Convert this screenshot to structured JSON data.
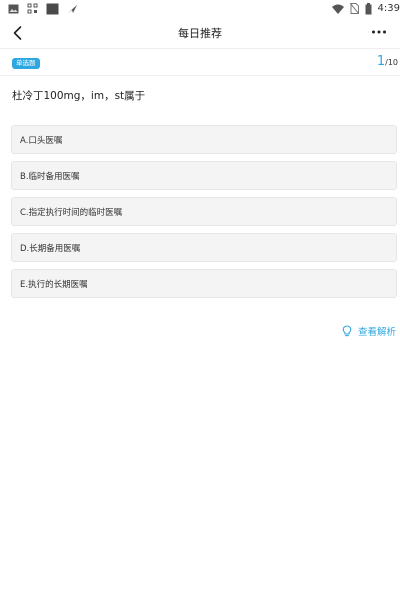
{
  "colors": {
    "accent": "#2ea7e0",
    "option_bg": "#f4f4f4",
    "option_border": "#e6e6e6"
  },
  "status_bar": {
    "time": "4:39",
    "left_icons": [
      "image-icon",
      "qr-scan-icon",
      "square-app-icon",
      "send-icon"
    ],
    "right_icons": [
      "wifi-icon",
      "no-sim-icon",
      "battery-icon"
    ]
  },
  "header": {
    "title": "每日推荐",
    "back_icon": "chevron-left-icon",
    "more_icon": "more-dots-icon"
  },
  "question_meta": {
    "type_badge": "单选题",
    "progress_current": "1",
    "progress_separator": "/",
    "progress_total": "10"
  },
  "question": {
    "text": "杜冷丁100mg，im，st属于"
  },
  "options": [
    {
      "label": "A.口头医嘱"
    },
    {
      "label": "B.临时备用医嘱"
    },
    {
      "label": "C.指定执行时间的临时医嘱"
    },
    {
      "label": "D.长期备用医嘱"
    },
    {
      "label": "E.执行的长期医嘱"
    }
  ],
  "analysis": {
    "label": "查看解析",
    "icon": "lightbulb-icon"
  }
}
